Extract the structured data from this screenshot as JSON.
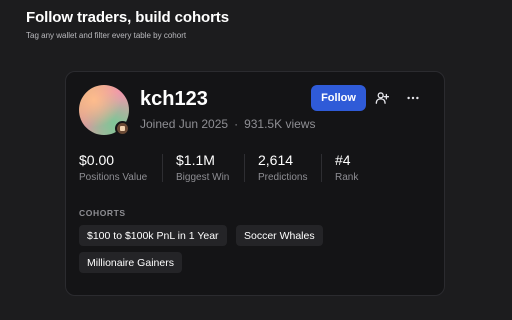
{
  "header": {
    "title": "Follow traders, build cohorts",
    "subtitle": "Tag any wallet and filter every table by cohort"
  },
  "profile": {
    "username": "kch123",
    "joined": "Joined Jun 2025",
    "separator": "·",
    "views": "931.5K views",
    "follow_label": "Follow",
    "icons": {
      "add_user": "add-user-icon",
      "more": "more-horizontal-icon"
    }
  },
  "stats": [
    {
      "value": "$0.00",
      "label": "Positions Value"
    },
    {
      "value": "$1.1M",
      "label": "Biggest Win"
    },
    {
      "value": "2,614",
      "label": "Predictions"
    },
    {
      "value": "#4",
      "label": "Rank"
    }
  ],
  "cohorts": {
    "label": "COHORTS",
    "items": [
      "$100 to $100k PnL in 1 Year",
      "Soccer Whales",
      "Millionaire Gainers"
    ]
  },
  "colors": {
    "background": "#1c1c1e",
    "card": "#141416",
    "accent": "#2f5bd8",
    "chip": "#242427",
    "muted_text": "#8e8e93"
  }
}
